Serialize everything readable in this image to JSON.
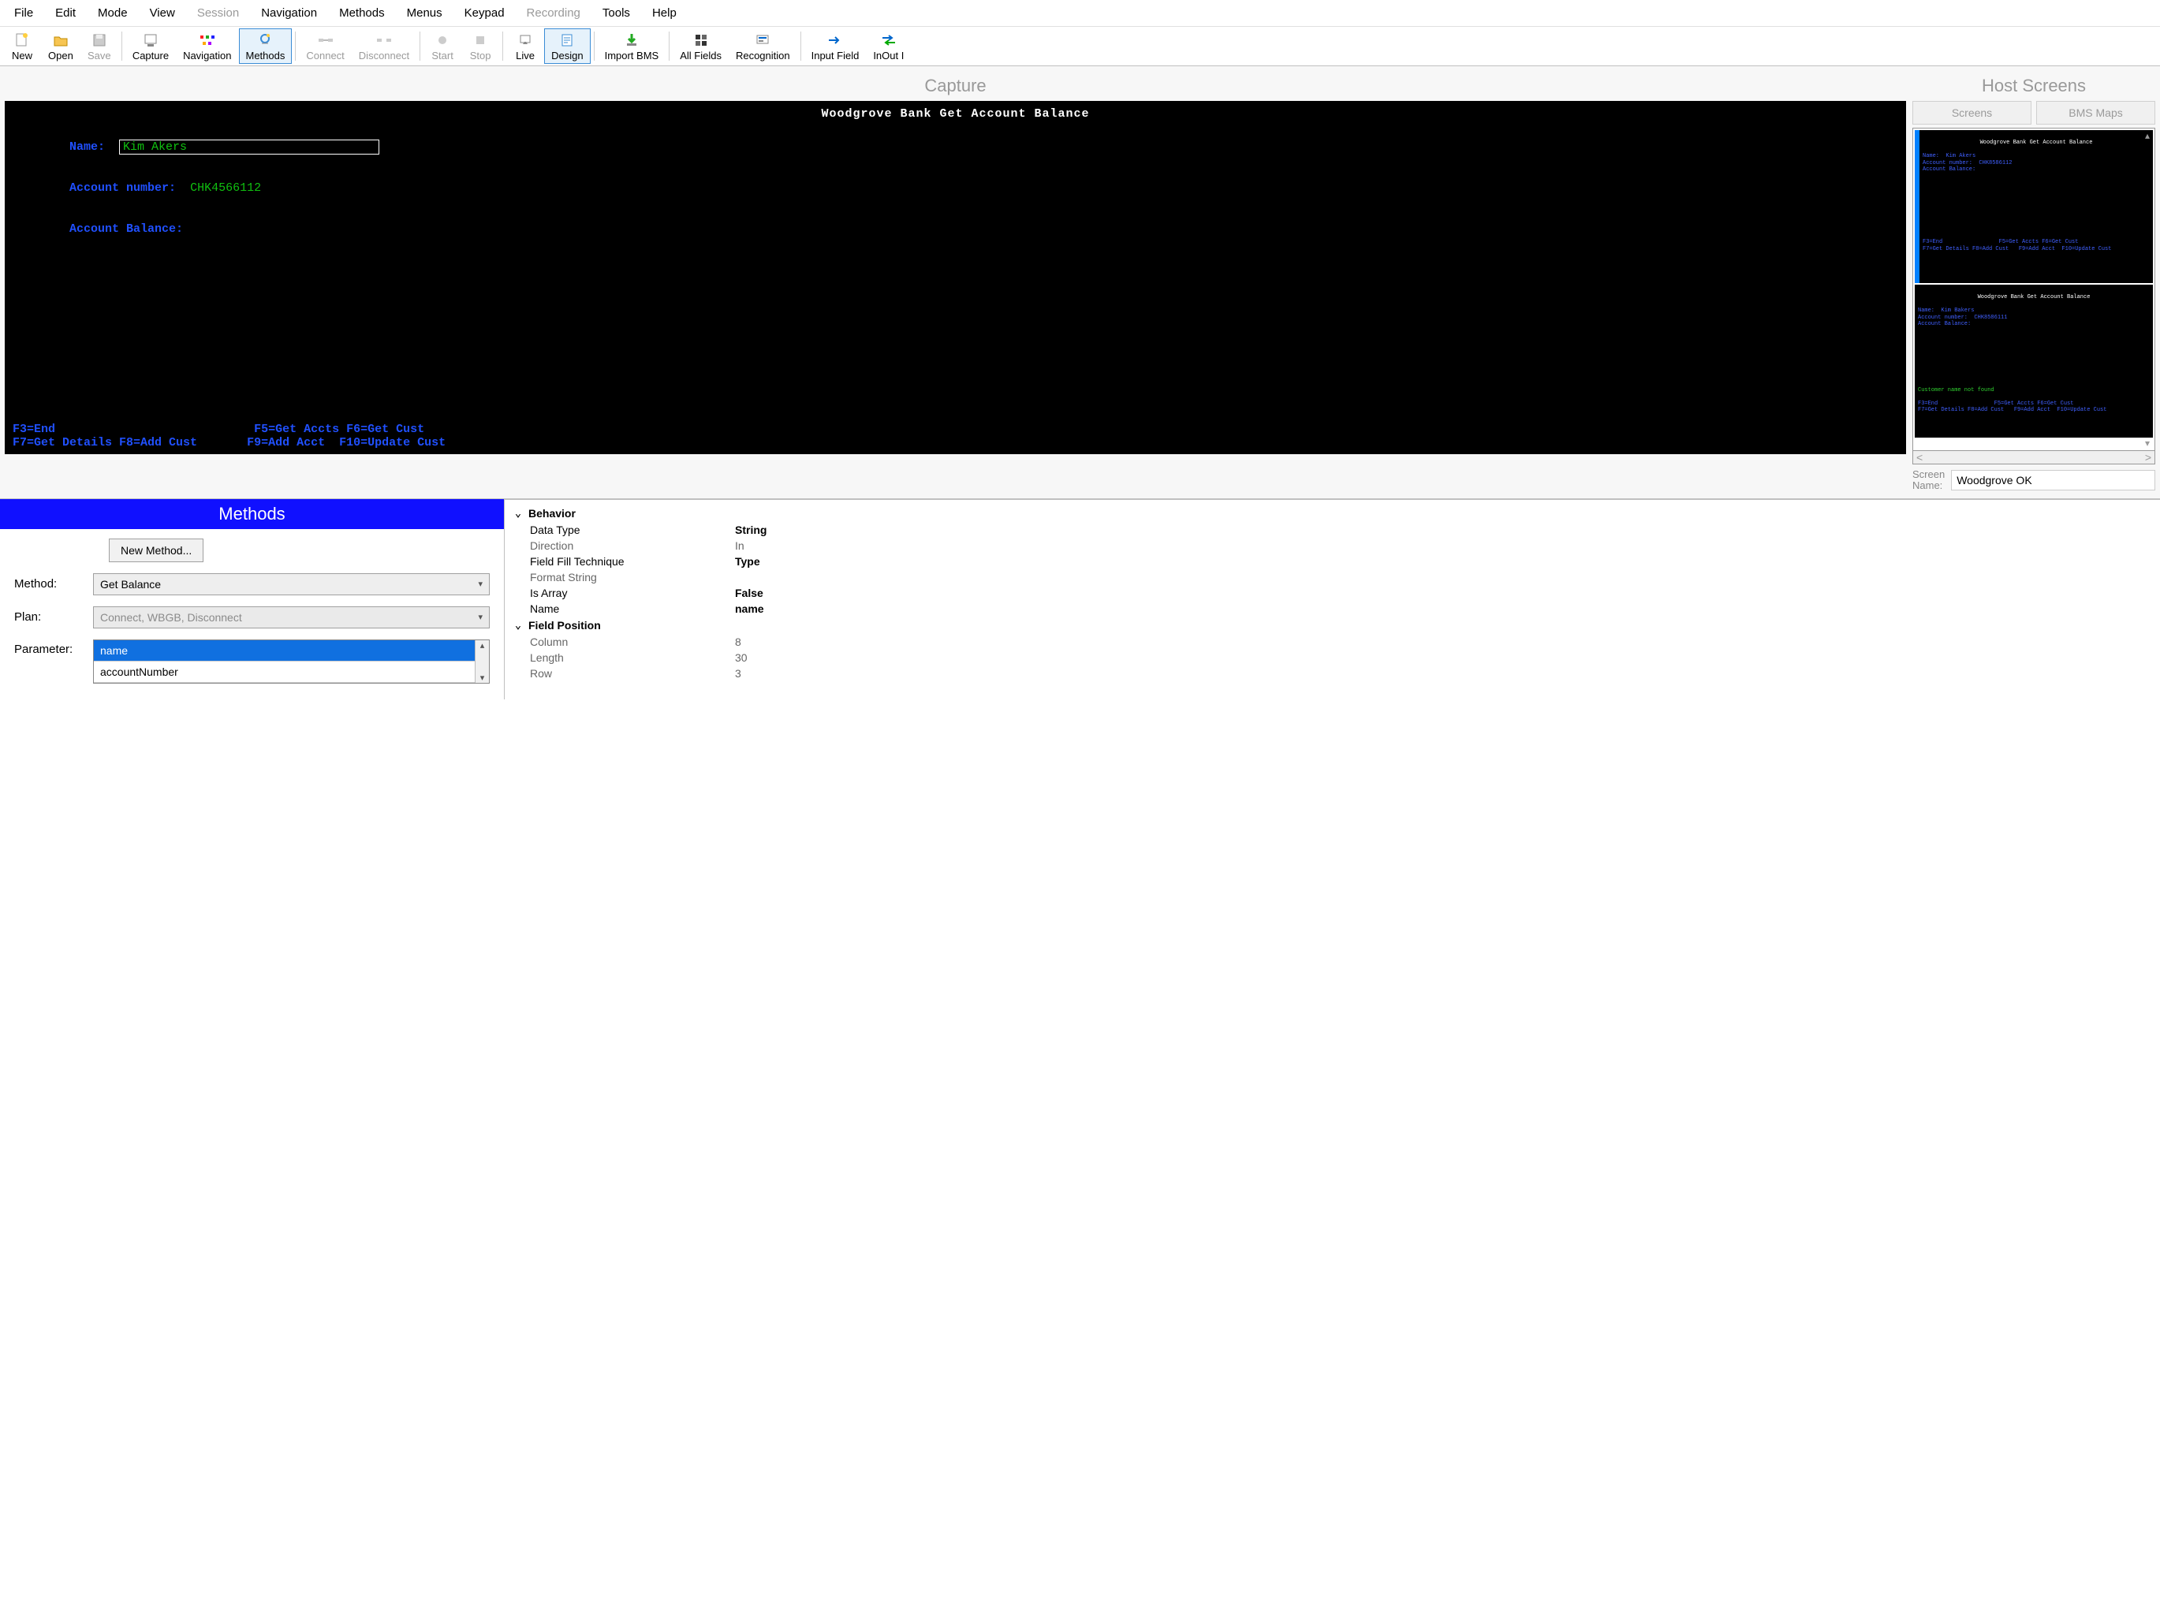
{
  "menubar": {
    "items": [
      {
        "label": "File",
        "enabled": true
      },
      {
        "label": "Edit",
        "enabled": true
      },
      {
        "label": "Mode",
        "enabled": true
      },
      {
        "label": "View",
        "enabled": true
      },
      {
        "label": "Session",
        "enabled": false
      },
      {
        "label": "Navigation",
        "enabled": true
      },
      {
        "label": "Methods",
        "enabled": true
      },
      {
        "label": "Menus",
        "enabled": true
      },
      {
        "label": "Keypad",
        "enabled": true
      },
      {
        "label": "Recording",
        "enabled": false
      },
      {
        "label": "Tools",
        "enabled": true
      },
      {
        "label": "Help",
        "enabled": true
      }
    ]
  },
  "toolbar": {
    "new": "New",
    "open": "Open",
    "save": "Save",
    "capture": "Capture",
    "navigation": "Navigation",
    "methods": "Methods",
    "connect": "Connect",
    "disconnect": "Disconnect",
    "start": "Start",
    "stop": "Stop",
    "live": "Live",
    "design": "Design",
    "import_bms": "Import BMS",
    "all_fields": "All Fields",
    "recognition": "Recognition",
    "input_field": "Input Field",
    "inout": "InOut I"
  },
  "capture": {
    "title": "Capture",
    "screen_title": "Woodgrove Bank Get Account Balance",
    "name_label": "Name:",
    "name_value": "Kim Akers",
    "account_number_label": "Account number:",
    "account_number_value": "CHK4566112",
    "account_balance_label": "Account Balance:",
    "footer": {
      "f3": "F3=End",
      "f5": "F5=Get Accts",
      "f6": "F6=Get Cust",
      "f7": "F7=Get Details",
      "f8": "F8=Add Cust",
      "f9": "F9=Add Acct",
      "f10": "F10=Update Cust"
    }
  },
  "host_screens": {
    "title": "Host Screens",
    "tab_screens": "Screens",
    "tab_bms": "BMS Maps",
    "thumbs": [
      {
        "title": "Woodgrove Bank Get Account Balance",
        "name_line": "Name:  Kim Akers",
        "acct_line": "Account number:  CHK8586112",
        "bal_line": "Account Balance:",
        "msg": "",
        "f_top": "F3=End                 F5=Get Accts F6=Get Cust",
        "f_bot": "F7=Get Details F8=Add Cust   F9=Add Acct  F10=Update Cust"
      },
      {
        "title": "Woodgrove Bank Get Account Balance",
        "name_line": "Name:  Kim Bakers",
        "acct_line": "Account number:  CHK8586111",
        "bal_line": "Account Balance:",
        "msg": "Customer name not found",
        "f_top": "F3=End                 F5=Get Accts F6=Get Cust",
        "f_bot": "F7=Get Details F8=Add Cust   F9=Add Acct  F10=Update Cust"
      }
    ],
    "screen_name_label": "Screen\nName:",
    "screen_name_value": "Woodgrove OK"
  },
  "methods": {
    "header": "Methods",
    "new_method_btn": "New Method...",
    "method_label": "Method:",
    "method_value": "Get Balance",
    "plan_label": "Plan:",
    "plan_value": "Connect, WBGB, Disconnect",
    "parameter_label": "Parameter:",
    "parameters": [
      {
        "label": "name",
        "selected": true
      },
      {
        "label": "accountNumber",
        "selected": false
      }
    ]
  },
  "properties": {
    "behavior": {
      "label": "Behavior",
      "rows": [
        {
          "name": "Data Type",
          "value": "String",
          "bold": true
        },
        {
          "name": "Direction",
          "value": "In",
          "bold": false
        },
        {
          "name": "Field Fill Technique",
          "value": "Type",
          "bold": true
        },
        {
          "name": "Format String",
          "value": "",
          "bold": false
        },
        {
          "name": "Is Array",
          "value": "False",
          "bold": true
        },
        {
          "name": "Name",
          "value": "name",
          "bold": true
        }
      ]
    },
    "field_position": {
      "label": "Field Position",
      "rows": [
        {
          "name": "Column",
          "value": "8",
          "bold": false
        },
        {
          "name": "Length",
          "value": "30",
          "bold": false
        },
        {
          "name": "Row",
          "value": "3",
          "bold": false
        }
      ]
    }
  }
}
